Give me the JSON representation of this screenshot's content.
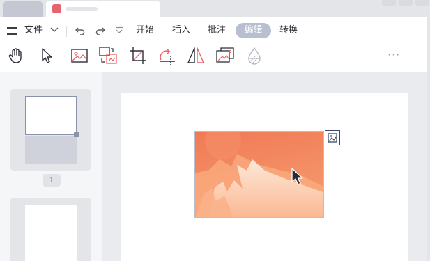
{
  "menu": {
    "file_label": "文件",
    "tabs": [
      {
        "label": "开始"
      },
      {
        "label": "插入"
      },
      {
        "label": "批注"
      },
      {
        "label": "编辑",
        "selected": true
      },
      {
        "label": "转换"
      }
    ]
  },
  "toolbar": {
    "tools": [
      "hand-icon",
      "select-arrow-icon",
      "image-icon",
      "replace-image-icon",
      "crop-icon",
      "rotate-icon",
      "flip-horizontal-icon",
      "image-edit-icon",
      "watermark-icon"
    ],
    "more_label": "···"
  },
  "thumbnails": [
    {
      "page_number": "1",
      "selected": true
    },
    {
      "page_number": "",
      "selected": false
    }
  ],
  "colors": {
    "accent": "#e8646c",
    "selected_tab_pill": "#b7bfd0",
    "image_gradient_top": "#f07a56",
    "image_gradient_bottom": "#fbb892"
  }
}
